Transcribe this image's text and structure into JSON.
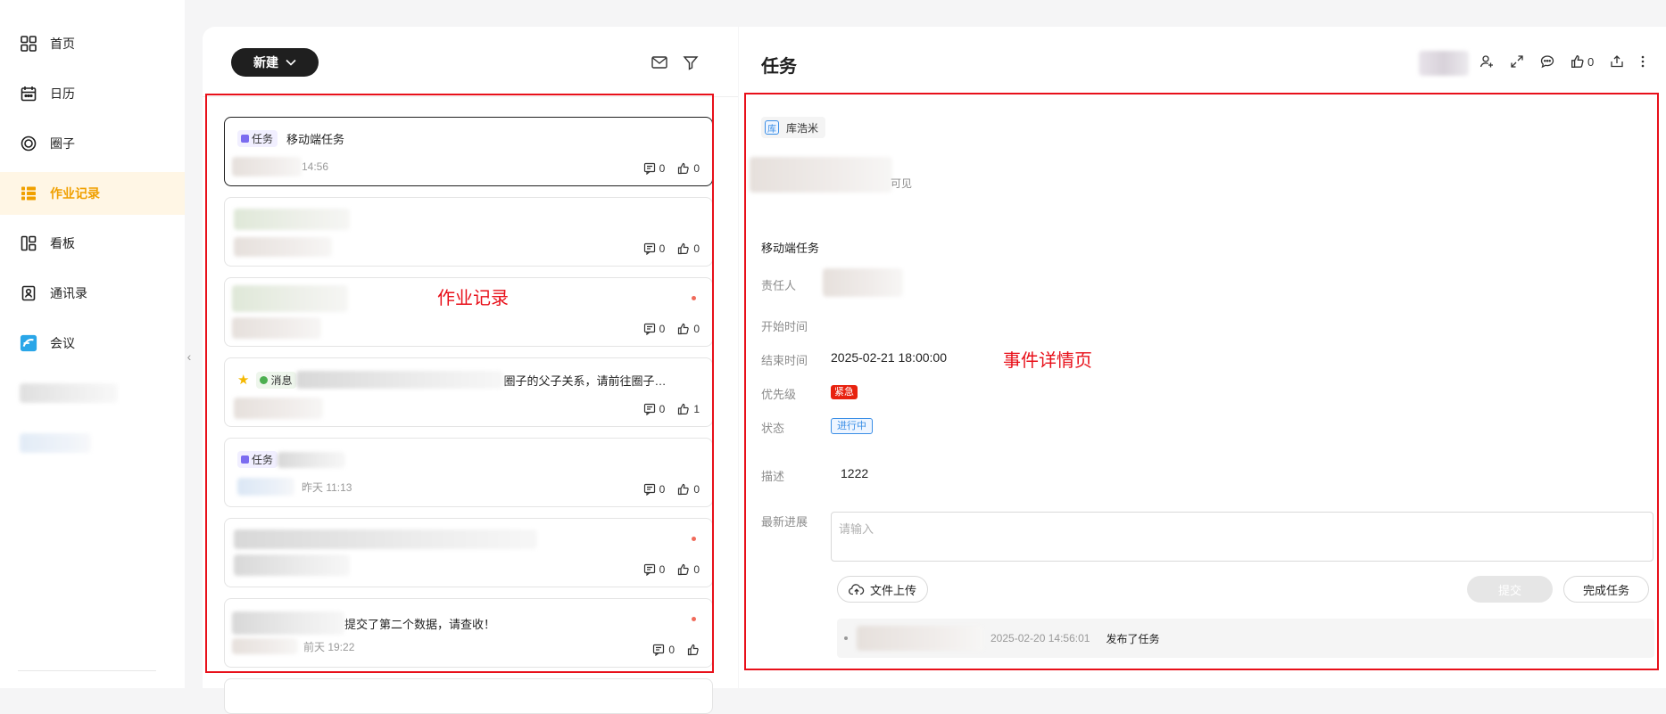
{
  "sidebar": {
    "items": [
      {
        "label": "首页",
        "icon": "grid-icon"
      },
      {
        "label": "日历",
        "icon": "calendar-icon"
      },
      {
        "label": "圈子",
        "icon": "circle-icon"
      },
      {
        "label": "作业记录",
        "icon": "list-icon",
        "active": true
      },
      {
        "label": "看板",
        "icon": "board-icon"
      },
      {
        "label": "通讯录",
        "icon": "contacts-icon"
      },
      {
        "label": "会议",
        "icon": "meeting-icon"
      }
    ]
  },
  "list": {
    "new_label": "新建",
    "overlay_label": "作业记录",
    "cards": [
      {
        "tag": "任务",
        "title": "移动端任务",
        "time": "14:56",
        "comments": "0",
        "likes": "0"
      },
      {
        "comments": "0",
        "likes": "0"
      },
      {
        "comments": "0",
        "likes": "0"
      },
      {
        "tag": "消息",
        "title_tail": "圈子的父子关系，请前往圈子…",
        "comments": "0",
        "likes": "1"
      },
      {
        "tag": "任务",
        "time": "昨天 11:13",
        "comments": "0",
        "likes": "0"
      },
      {
        "comments": "0",
        "likes": "0"
      },
      {
        "title_tail": "提交了第二个数据，请查收！",
        "time": "前天 19:22",
        "comments": "0"
      }
    ]
  },
  "detail": {
    "title": "任务",
    "like_count": "0",
    "overlay_label": "事件详情页",
    "chip_icon_text": "库",
    "chip_label": "库浩米",
    "visibility_fragment": "可见",
    "task_name": "移动端任务",
    "fields": {
      "owner_label": "责任人",
      "start_label": "开始时间",
      "end_label": "结束时间",
      "end_value": "2025-02-21 18:00:00",
      "priority_label": "优先级",
      "priority_value": "紧急",
      "status_label": "状态",
      "status_value": "进行中",
      "desc_label": "描述",
      "desc_value": "1222",
      "progress_label": "最新进展"
    },
    "progress_placeholder": "请输入",
    "upload_label": "文件上传",
    "submit_label": "提交",
    "complete_label": "完成任务",
    "activity": {
      "time": "2025-02-20 14:56:01",
      "action": "发布了任务"
    }
  }
}
